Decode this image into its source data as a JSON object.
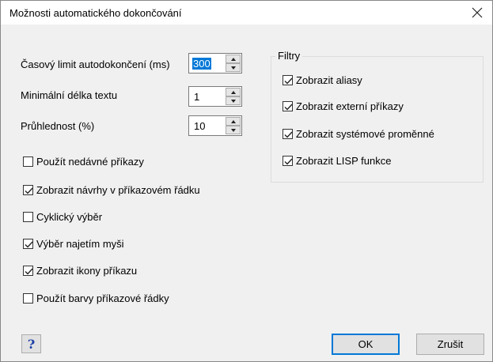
{
  "dialog": {
    "title": "Možnosti automatického dokončování",
    "close_glyph": "✕"
  },
  "fields": [
    {
      "label": "Časový limit autodokončení (ms)",
      "value": "300",
      "selected": true
    },
    {
      "label": "Minimální délka textu",
      "value": "1",
      "selected": false
    },
    {
      "label": "Průhlednost (%)",
      "value": "10",
      "selected": false
    }
  ],
  "options": [
    {
      "label": "Použít nedávné příkazy",
      "checked": false
    },
    {
      "label": "Zobrazit návrhy v příkazovém řádku",
      "checked": true
    },
    {
      "label": "Cyklický výběr",
      "checked": false
    },
    {
      "label": "Výběr najetím myši",
      "checked": true
    },
    {
      "label": "Zobrazit ikony příkazu",
      "checked": true
    },
    {
      "label": "Použít barvy příkazové řádky",
      "checked": false
    }
  ],
  "filters": {
    "title": "Filtry",
    "items": [
      {
        "label": "Zobrazit aliasy",
        "checked": true
      },
      {
        "label": "Zobrazit externí příkazy",
        "checked": true
      },
      {
        "label": "Zobrazit systémové proměnné",
        "checked": true
      },
      {
        "label": "Zobrazit LISP funkce",
        "checked": true
      }
    ]
  },
  "buttons": {
    "help": "?",
    "ok": "OK",
    "cancel": "Zrušit"
  },
  "colors": {
    "accent": "#0078d7",
    "dialog_bg": "#f0f0f0"
  }
}
